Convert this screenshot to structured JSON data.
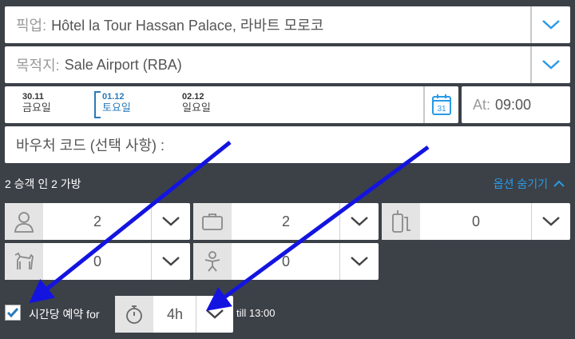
{
  "pickup": {
    "label": "픽업:",
    "value": "Hôtel la Tour Hassan Palace, 라바트 모로코"
  },
  "destination": {
    "label": "목적지:",
    "value": "Sale Airport (RBA)"
  },
  "dates": [
    {
      "date": "30.11",
      "weekday": "금요일"
    },
    {
      "date": "01.12",
      "weekday": "토요일",
      "selected": true
    },
    {
      "date": "02.12",
      "weekday": "일요일"
    }
  ],
  "calendar_day": "31",
  "time": {
    "label": "At:",
    "value": "09:00"
  },
  "voucher": {
    "placeholder": "바우처 코드 (선택 사항) :"
  },
  "summary": "2 승객 인 2 가방",
  "options_toggle": "옵션 숨기기",
  "steppers": {
    "passengers": "2",
    "luggage": "2",
    "sport_equipment": "0",
    "pets": "0",
    "child_seats": "0"
  },
  "hourly": {
    "checked": true,
    "label": "시간당 예약 for",
    "duration": "4h",
    "till": "till 13:00"
  },
  "colors": {
    "accent": "#2a9ae6",
    "background": "#3c4148",
    "arrow": "#1414e0"
  }
}
